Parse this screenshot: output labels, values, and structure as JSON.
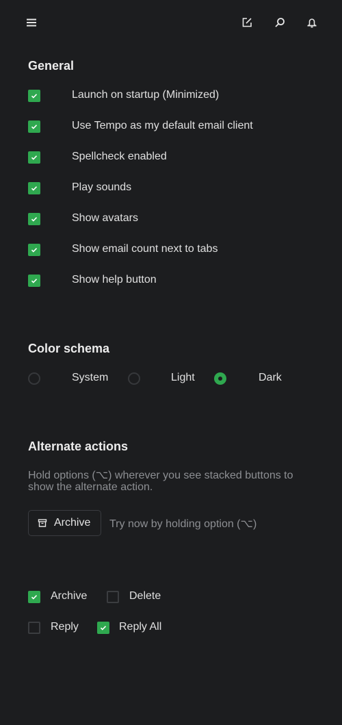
{
  "toolbar": {
    "menu_icon": "hamburger-menu-icon",
    "compose_icon": "compose-icon",
    "search_icon": "search-icon",
    "notifications_icon": "bell-icon"
  },
  "general": {
    "title": "General",
    "options": [
      {
        "label": "Launch on startup (Minimized)",
        "checked": true
      },
      {
        "label": "Use Tempo as my default email client",
        "checked": true
      },
      {
        "label": "Spellcheck enabled",
        "checked": true
      },
      {
        "label": "Play sounds",
        "checked": true
      },
      {
        "label": "Show avatars",
        "checked": true
      },
      {
        "label": "Show email count next to tabs",
        "checked": true
      },
      {
        "label": "Show help button",
        "checked": true
      }
    ]
  },
  "color_schema": {
    "title": "Color schema",
    "options": [
      {
        "label": "System",
        "selected": false
      },
      {
        "label": "Light",
        "selected": false
      },
      {
        "label": "Dark",
        "selected": true
      }
    ]
  },
  "alternate_actions": {
    "title": "Alternate actions",
    "description": "Hold options (⌥) wherever you see stacked buttons to show the alternate action.",
    "demo_button_label": "Archive",
    "demo_button_icon": "archive-icon",
    "try_text": "Try now by holding option (⌥)",
    "pairs": [
      {
        "label": "Archive",
        "checked": true
      },
      {
        "label": "Delete",
        "checked": false
      },
      {
        "label": "Reply",
        "checked": false
      },
      {
        "label": "Reply All",
        "checked": true
      }
    ]
  },
  "colors": {
    "background": "#1c1d1f",
    "accent": "#2fa84f",
    "muted_text": "#8d8f93"
  }
}
